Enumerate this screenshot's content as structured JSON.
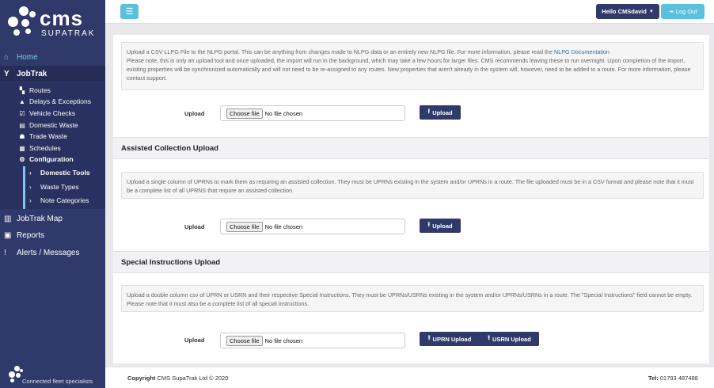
{
  "brand": {
    "name": "cms",
    "subtitle": "SUPATRAK",
    "tagline": "Connected fleet specialists"
  },
  "nav": {
    "home": "Home",
    "jobtrak": "JobTrak",
    "jobtrak_items": [
      "Routes",
      "Delays & Exceptions",
      "Vehicle Checks",
      "Domestic Waste",
      "Trade Waste",
      "Schedules",
      "Configuration"
    ],
    "config_items": [
      "Domestic Tools",
      "Waste Types",
      "Note Categories"
    ],
    "jobtrak_map": "JobTrak Map",
    "reports": "Reports",
    "alerts": "Alerts / Messages"
  },
  "topbar": {
    "menu_icon": "☰",
    "user": "Hello CMSdavid",
    "logout": "Log Out"
  },
  "sections": {
    "llpg": {
      "info_before_link": "Upload a CSV LLPG File to the NLPG portal. This can be anything from changes made to NLPG data or an entirely new NLPG file. For more information, please read the ",
      "info_link": "NLPG Documentation",
      "info_after_link": "Please note, this is only an upload tool and once uploaded, the import will run in the background, which may take a few hours for larger files. CMS recommends leaving these to run overnight. Upon completion of the import, existing properties will be synchronized automatically and will not need to be re-assigned to any routes. New properties that aren't already in the system will, however, need to be added to a route. For more information, please contact support.",
      "upload_label": "Upload",
      "choose_file": "Choose file",
      "no_file": "No file chosen",
      "button": "Upload"
    },
    "assisted": {
      "title": "Assisted Collection Upload",
      "info": "Upload a single column of UPRNs to mark them as requiring an assisted collection. They must be UPRNs existing in the system and/or UPRNs in a route. The file uploaded must be in a CSV format and please note that it must be a complete list of all UPRNS that require an assisted collection.",
      "upload_label": "Upload",
      "choose_file": "Choose file",
      "no_file": "No file chosen",
      "button": "Upload"
    },
    "special": {
      "title": "Special Instructions Upload",
      "info": "Upload a double column csv of UPRN or USRN and their respective Special Instructions. They must be UPRNs/USRNs existing in the system and/or UPRNs/USRNs in a route. The \"Special Instructions\" field cannot be empty. Please note that it must also be a complete list of all special instructions.",
      "upload_label": "Upload",
      "choose_file": "Choose file",
      "no_file": "No file chosen",
      "button_uprn": "UPRN Upload",
      "button_usrn": "USRN Upload"
    }
  },
  "footer": {
    "copyright_label": "Copyright",
    "copyright_text": "CMS SupaTrak Ltd © 2020",
    "tel_label": "Tel:",
    "tel_value": "01793 487488"
  }
}
